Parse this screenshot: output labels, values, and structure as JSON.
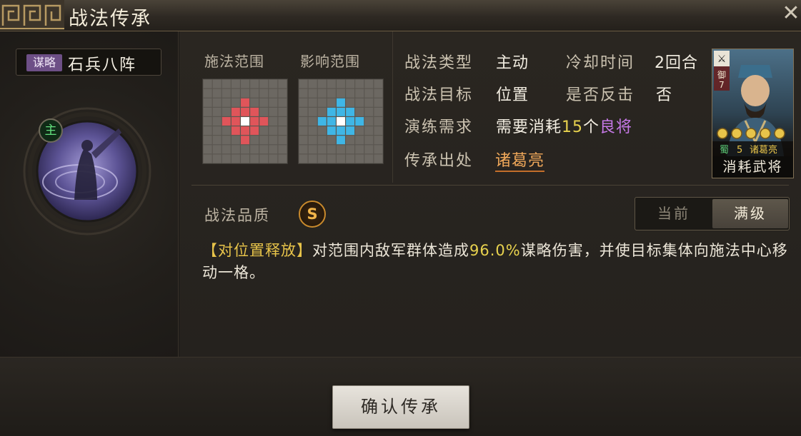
{
  "window": {
    "title": "战法传承",
    "close_icon": "close-x-icon"
  },
  "skill": {
    "tag": "谋略",
    "name": "石兵八阵",
    "role_badge": "主"
  },
  "ranges": {
    "cast_label": "施法范围",
    "effect_label": "影响范围",
    "cast_color": "#e0555a",
    "effect_color": "#3fb6e6",
    "center_color": "#ffffff"
  },
  "info": {
    "type_label": "战法类型",
    "type_value": "主动",
    "cooldown_label": "冷却时间",
    "cooldown_value": "2回合",
    "target_label": "战法目标",
    "target_value": "位置",
    "counter_label": "是否反击",
    "counter_value": "否",
    "train_label": "演练需求",
    "train_prefix": "需要消耗",
    "train_count": "15",
    "train_unit": "个",
    "train_grade": "良将",
    "source_label": "传承出处",
    "source_value": "诸葛亮"
  },
  "general_card": {
    "class_mark": "御",
    "level": "7",
    "faction": "蜀",
    "stars": "5",
    "name": "诸葛亮",
    "footer": "消耗武将"
  },
  "quality": {
    "label": "战法品质",
    "grade": "S"
  },
  "level_toggle": {
    "current": "当前",
    "max": "满级",
    "selected": "max"
  },
  "description": {
    "tag": "【对位置释放】",
    "part1": "对范围内敌军群体造成",
    "number": "96.0%",
    "part2": "谋略伤害，并使目标集体向施法中心移动一格。"
  },
  "footer": {
    "confirm_label": "确认传承"
  },
  "colors": {
    "accent_gold": "#e8d24e",
    "purple_grade": "#c779e8",
    "link_orange": "#f0a85a"
  }
}
